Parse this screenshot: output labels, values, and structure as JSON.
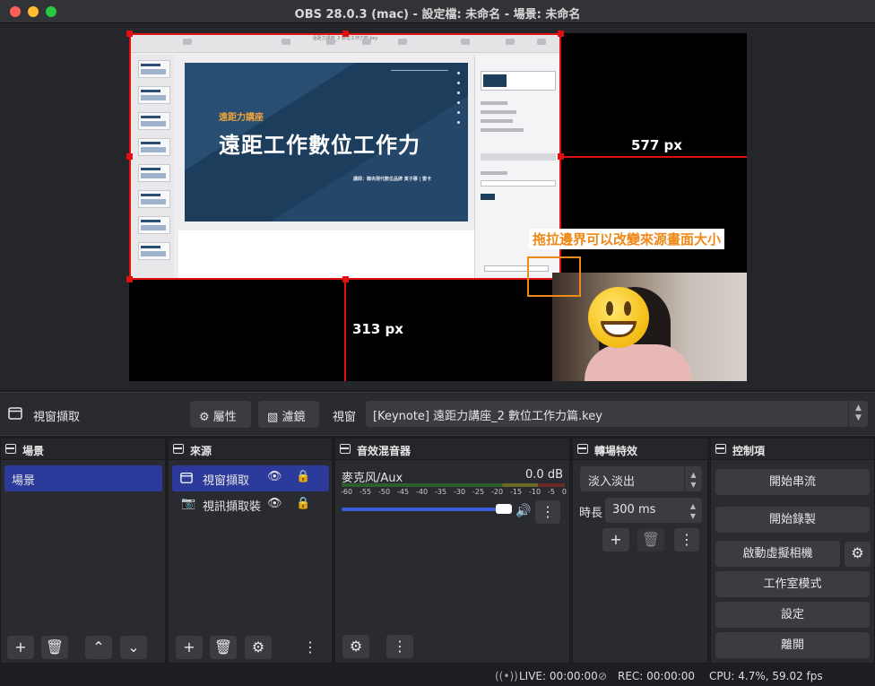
{
  "window": {
    "title": "OBS 28.0.3 (mac) - 設定檔: 未命名 - 場景: 未命名"
  },
  "preview": {
    "slide_kicker": "遠距力講座",
    "slide_title": "遠距工作數位工作力",
    "slide_sub": "講師：韓央現代數位品牌 寅子穆 | 雷卡",
    "keynote_title": "遠距力講座_2 數位工作力篇.key",
    "width_label": "577 px",
    "height_label": "313 px",
    "hint": "拖拉邊界可以改變來源畫面大小"
  },
  "source_bar": {
    "source_name": "視窗擷取",
    "properties": "屬性",
    "filters": "濾鏡",
    "window_label": "視窗",
    "window_value": "[Keynote] 遠距力講座_2 數位工作力篇.key"
  },
  "scenes": {
    "title": "場景",
    "items": [
      "場景"
    ]
  },
  "sources": {
    "title": "來源",
    "items": [
      "視窗擷取",
      "視訊擷取裝"
    ]
  },
  "mixer": {
    "title": "音效混音器",
    "channel": "麥克风/Aux",
    "level": "0.0 dB",
    "ticks": [
      "-60",
      "-55",
      "-50",
      "-45",
      "-40",
      "-35",
      "-30",
      "-25",
      "-20",
      "-15",
      "-10",
      "-5",
      "0"
    ]
  },
  "transitions": {
    "title": "轉場特效",
    "type": "淡入淡出",
    "duration_label": "時長",
    "duration": "300 ms"
  },
  "controls": {
    "title": "控制項",
    "start_stream": "開始串流",
    "start_record": "開始錄製",
    "virtual_cam": "啟動虛擬相機",
    "studio_mode": "工作室模式",
    "settings": "設定",
    "exit": "離開"
  },
  "status": {
    "live": "LIVE: 00:00:00",
    "rec": "REC: 00:00:00",
    "cpu": "CPU: 4.7%, 59.02 fps"
  },
  "colors": {
    "accent": "#2c3b9b",
    "selection_red": "#e01010",
    "hint_orange": "#ef8a19"
  }
}
